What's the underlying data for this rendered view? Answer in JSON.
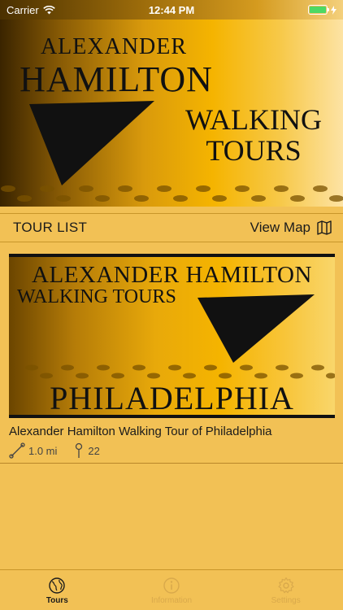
{
  "status_bar": {
    "carrier": "Carrier",
    "time": "12:44 PM"
  },
  "hero": {
    "line1": "ALEXANDER",
    "line2": "HAMILTON",
    "line3": "WALKING",
    "line4": "TOURS"
  },
  "tour_list": {
    "title": "TOUR LIST",
    "view_map_label": "View Map"
  },
  "tours": [
    {
      "image_line1": "ALEXANDER HAMILTON",
      "image_line2": "WALKING TOURS",
      "image_city": "PHILADELPHIA",
      "name": "Alexander Hamilton Walking Tour of Philadelphia",
      "distance": "1.0 mi",
      "stops": "22"
    }
  ],
  "tab_bar": {
    "tabs": [
      {
        "label": "Tours",
        "icon": "globe-icon",
        "active": true
      },
      {
        "label": "Information",
        "icon": "info-icon",
        "active": false
      },
      {
        "label": "Settings",
        "icon": "gear-icon",
        "active": false
      }
    ]
  },
  "colors": {
    "background": "#f2c155",
    "accent_gold": "#f5b400",
    "inactive_tab": "#d9a94b",
    "battery": "#4cd964"
  }
}
